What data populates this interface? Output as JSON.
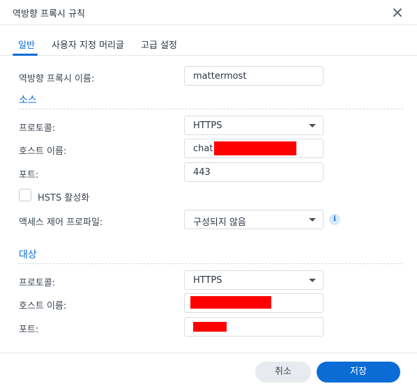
{
  "dialog": {
    "title": "역방향 프록시 규칙"
  },
  "tabs": [
    {
      "label": "일반",
      "active": true
    },
    {
      "label": "사용자 지정 머리글",
      "active": false
    },
    {
      "label": "고급 설정",
      "active": false
    }
  ],
  "general": {
    "name_label": "역방향 프록시 이름:",
    "name_value": "mattermost"
  },
  "source": {
    "heading": "소스",
    "protocol_label": "프로토콜:",
    "protocol_value": "HTTPS",
    "hostname_label": "호스트 이름:",
    "hostname_value": "chat.",
    "port_label": "포트:",
    "port_value": "443",
    "hsts_label": "HSTS 활성화",
    "hsts_checked": false,
    "access_profile_label": "액세스 제어 프로파일:",
    "access_profile_value": "구성되지 않음"
  },
  "destination": {
    "heading": "대상",
    "protocol_label": "프로토콜:",
    "protocol_value": "HTTPS",
    "hostname_label": "호스트 이름:",
    "port_label": "포트:"
  },
  "footer": {
    "cancel_label": "취소",
    "save_label": "저장"
  },
  "colors": {
    "accent": "#0b6cd5",
    "redaction": "#ff0000"
  },
  "icons": {
    "close": "close-icon",
    "info": "info-icon",
    "dropdown": "chevron-down-icon"
  }
}
